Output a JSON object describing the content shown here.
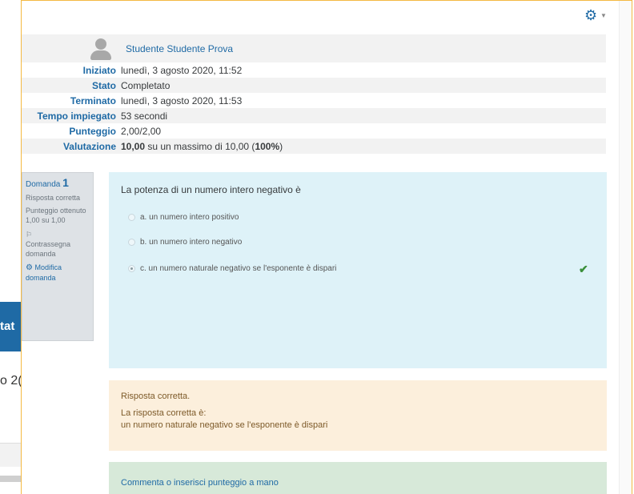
{
  "background": {
    "heading_fragment": "tat",
    "text_fragment": "o 2("
  },
  "user": {
    "name": "Studente Studente Prova"
  },
  "summary": [
    {
      "label": "Iniziato",
      "value": "lunedì, 3 agosto 2020, 11:52"
    },
    {
      "label": "Stato",
      "value": "Completato"
    },
    {
      "label": "Terminato",
      "value": "lunedì, 3 agosto 2020, 11:53"
    },
    {
      "label": "Tempo impiegato",
      "value": "53 secondi"
    },
    {
      "label": "Punteggio",
      "value": "2,00/2,00"
    },
    {
      "label": "Valutazione",
      "grade_bold": "10,00",
      "grade_mid": " su un massimo di 10,00 (",
      "grade_pct": "100%",
      "grade_end": ")"
    }
  ],
  "question_info": {
    "label": "Domanda",
    "number": "1",
    "state": "Risposta corretta",
    "score": "Punteggio ottenuto 1,00 su 1,00",
    "flag": "Contrassegna domanda",
    "edit": "Modifica domanda"
  },
  "question": {
    "text": "La potenza di un numero intero negativo è",
    "answers": [
      {
        "text": "a. un numero intero positivo",
        "checked": false
      },
      {
        "text": "b. un numero intero negativo",
        "checked": false
      },
      {
        "text": "c. un numero naturale negativo se l'esponente è dispari",
        "checked": true
      }
    ]
  },
  "feedback": {
    "result": "Risposta corretta.",
    "correct_label": "La risposta corretta è:",
    "correct_answer": "un numero naturale negativo se l'esponente è dispari"
  },
  "comment": {
    "link": "Commenta o inserisci punteggio a mano"
  },
  "colors": {
    "link_blue": "#1f6aa5",
    "question_bg": "#def2f8",
    "feedback_bg": "#fcefdc",
    "comment_bg": "#d7e9d9",
    "correct_green": "#3a8f3a",
    "window_border": "#f4b942"
  },
  "icons": {
    "gear": "gear-icon",
    "check": "checkmark-icon",
    "edit": "gear-icon",
    "avatar": "user-avatar-icon",
    "flag": "flag-icon"
  }
}
